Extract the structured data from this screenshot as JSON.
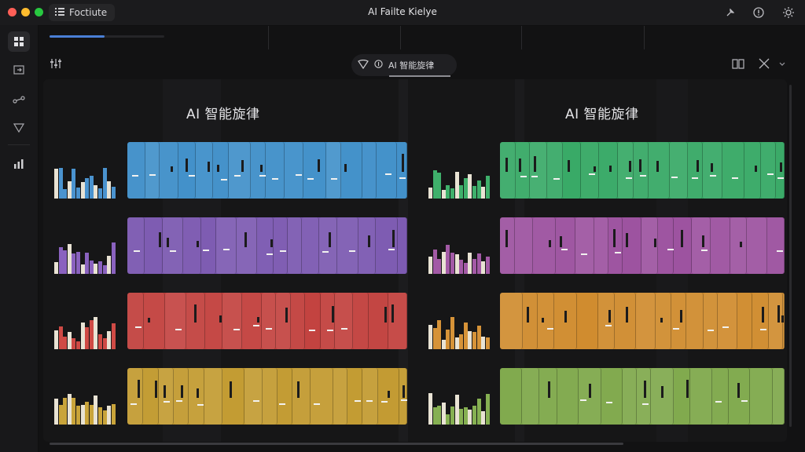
{
  "window": {
    "title": "AI Failte Kielye",
    "sidebar_toggle_label": "Foctiute"
  },
  "titlebar_icons": [
    "pin-icon",
    "info-icon",
    "settings-icon"
  ],
  "rail": {
    "items": [
      "grid-icon",
      "import-icon",
      "link-icon",
      "filter-icon",
      "chart-icon"
    ],
    "active_index": 0
  },
  "progress": {
    "fraction": 0.48
  },
  "toolbar": {
    "left_icon": "mixer-icon",
    "tab_label": "AI 智能旋律",
    "tab_icons": [
      "shield-icon",
      "info-icon"
    ],
    "right_icons": [
      "book-icon",
      "shuffle-icon",
      "chevron-down-icon"
    ]
  },
  "panels": [
    {
      "title": "AI 智能旋律",
      "tracks": [
        {
          "color": "#3f8fc9",
          "lead": "#4a93cf"
        },
        {
          "color": "#7a57b0",
          "lead": "#8a62bf"
        },
        {
          "color": "#c2403d",
          "lead": "#cf4a45"
        },
        {
          "color": "#c29a2f",
          "lead": "#c9a43a"
        }
      ]
    },
    {
      "title": "AI 智能旋律",
      "tracks": [
        {
          "color": "#35a864",
          "lead": "#3fb06b"
        },
        {
          "color": "#9b4f9e",
          "lead": "#a35aa6"
        },
        {
          "color": "#cf8a2b",
          "lead": "#d69338"
        },
        {
          "color": "#7ea84a",
          "lead": "#86b052"
        }
      ]
    }
  ]
}
